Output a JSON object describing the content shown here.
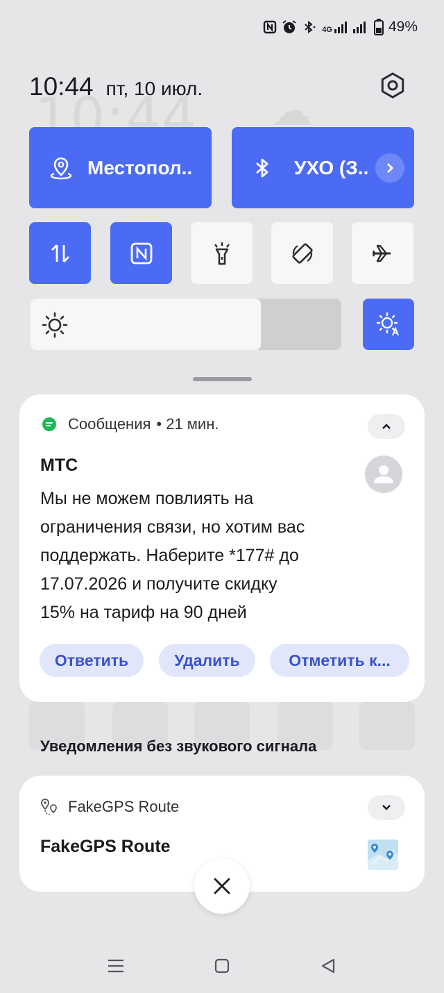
{
  "status_bar": {
    "icons": [
      "nfc-icon",
      "alarm-icon",
      "bluetooth-icon",
      "4g-signal-icon",
      "signal-icon",
      "battery-icon"
    ],
    "network_label": "4G",
    "battery_percent": "49%"
  },
  "header": {
    "time": "10:44",
    "date": "пт, 10 июл."
  },
  "quick_settings": {
    "location_label": "Местопол..",
    "bluetooth_label": "УХО (З..",
    "tiles": [
      {
        "name": "mobile-data",
        "active": true
      },
      {
        "name": "nfc",
        "active": true
      },
      {
        "name": "flashlight",
        "active": false
      },
      {
        "name": "auto-rotate",
        "active": false
      },
      {
        "name": "airplane-mode",
        "active": false
      }
    ],
    "brightness_level": 0.74,
    "auto_brightness_active": true
  },
  "notification_sms": {
    "app_name": "Сообщения",
    "time_ago": "• 21 мин.",
    "sender": "МТС",
    "message_lines": [
      "Мы не можем повлиять на",
      "ограничения связи, но хотим вас",
      "поддержать. Наберите *177# до",
      "17.07.2026 и получите скидку",
      "15% на тариф на 90 дней"
    ],
    "actions": {
      "reply": "Ответить",
      "delete": "Удалить",
      "mark": "Отметить к..."
    }
  },
  "silent_section": {
    "label": "Уведомления без звукового сигнала"
  },
  "notification_gps": {
    "app_name": "FakeGPS Route",
    "title": "FakeGPS Route"
  },
  "colors": {
    "accent": "#4b6bf5",
    "background": "#e6e6e8",
    "card": "#ffffff",
    "action_bg": "#e2e6fb",
    "action_text": "#3a52c9",
    "messages_green": "#1db954"
  }
}
